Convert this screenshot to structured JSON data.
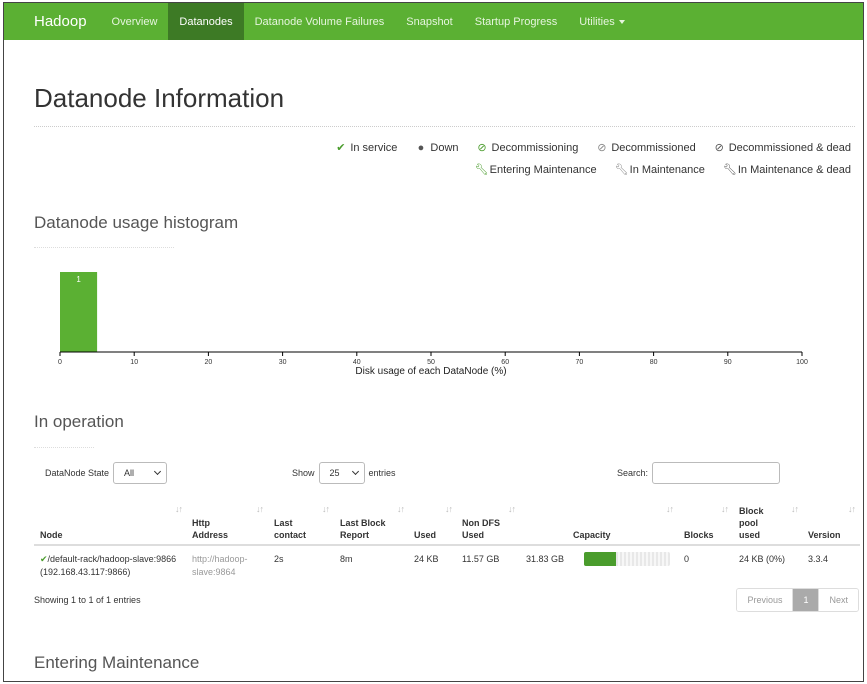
{
  "nav": {
    "brand": "Hadoop",
    "items": [
      {
        "label": "Overview",
        "active": false
      },
      {
        "label": "Datanodes",
        "active": true
      },
      {
        "label": "Datanode Volume Failures",
        "active": false
      },
      {
        "label": "Snapshot",
        "active": false
      },
      {
        "label": "Startup Progress",
        "active": false
      },
      {
        "label": "Utilities",
        "active": false
      }
    ]
  },
  "page_title": "Datanode Information",
  "legend": {
    "in_service": "In service",
    "down": "Down",
    "decommissioning": "Decommissioning",
    "decommissioned": "Decommissioned",
    "decommissioned_dead": "Decommissioned & dead",
    "entering_maintenance": "Entering Maintenance",
    "in_maintenance": "In Maintenance",
    "in_maintenance_dead": "In Maintenance & dead"
  },
  "histogram_title": "Datanode usage histogram",
  "chart_data": {
    "type": "bar",
    "xlabel": "Disk usage of each DataNode (%)",
    "xlim": [
      0,
      100
    ],
    "xticks": [
      0,
      10,
      20,
      30,
      40,
      50,
      60,
      70,
      80,
      90,
      100
    ],
    "bins": [
      {
        "start": 0,
        "end": 5,
        "count": 1
      }
    ],
    "bar_color": "#5bb033"
  },
  "in_operation_title": "In operation",
  "controls": {
    "state_label": "DataNode State",
    "state_value": "All",
    "show_label": "Show",
    "show_value": "25",
    "entries_label": "entries",
    "search_label": "Search:"
  },
  "table": {
    "headers": {
      "node": "Node",
      "http1": "Http",
      "http2": "Address",
      "last1": "Last",
      "last2": "contact",
      "lbr1": "Last Block",
      "lbr2": "Report",
      "used": "Used",
      "ndfs1": "Non DFS",
      "ndfs2": "Used",
      "capacity": "Capacity",
      "blocks": "Blocks",
      "bp1": "Block",
      "bp2": "pool",
      "bp3": "used",
      "version": "Version"
    },
    "row": {
      "node1": "/default-rack/hadoop-slave:9866",
      "node2": "(192.168.43.117:9866)",
      "http1": "http://hadoop-",
      "http2": "slave:9864",
      "last_contact": "2s",
      "last_block_report": "8m",
      "used": "24 KB",
      "non_dfs_used": "11.57 GB",
      "capacity": "31.83 GB",
      "capacity_fill_fraction": 0.37,
      "blocks": "0",
      "block_pool_used": "24 KB (0%)",
      "version": "3.3.4"
    }
  },
  "showing": "Showing 1 to 1 of 1 entries",
  "pager": {
    "prev": "Previous",
    "page": "1",
    "next": "Next"
  },
  "entering_maintenance_title": "Entering Maintenance",
  "colors": {
    "navbar": "#5bb033",
    "nav_active": "#3d7a25",
    "ok_green": "#4a9c2c"
  }
}
